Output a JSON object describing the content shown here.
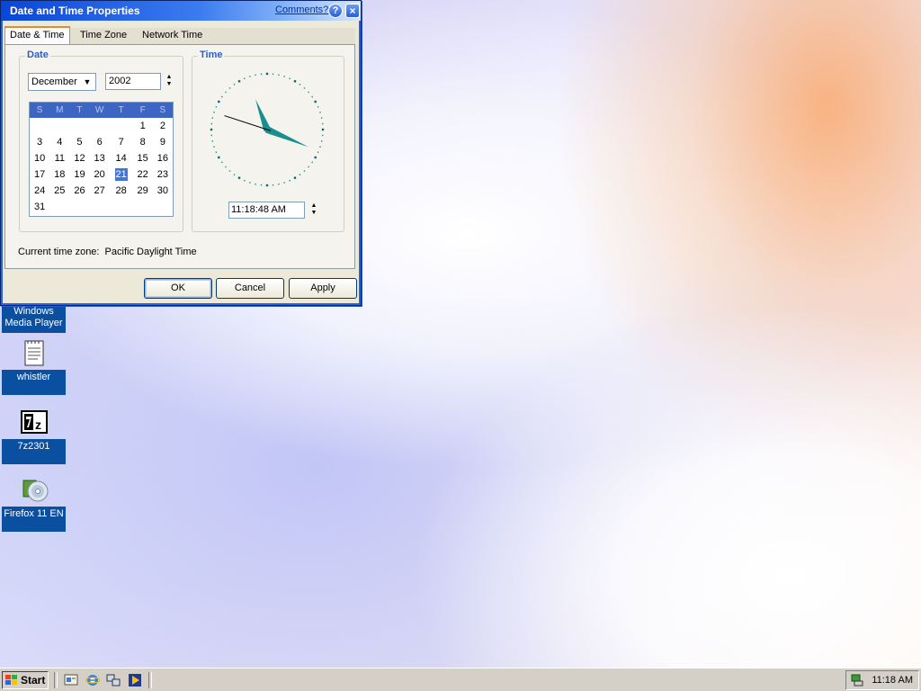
{
  "dialog": {
    "title": "Date and Time Properties",
    "comments_link": "Comments?",
    "help_label": "?",
    "close_label": "×",
    "tabs": [
      {
        "label": "Date & Time",
        "active": true
      },
      {
        "label": "Time Zone",
        "active": false
      },
      {
        "label": "Network Time",
        "active": false
      }
    ],
    "date_group_title": "Date",
    "time_group_title": "Time",
    "month_value": "December",
    "year_value": "2002",
    "calendar": {
      "day_headers": [
        "S",
        "M",
        "T",
        "W",
        "T",
        "F",
        "S"
      ],
      "weeks": [
        [
          "",
          "",
          "",
          "",
          "",
          "1",
          "2"
        ],
        [
          "3",
          "4",
          "5",
          "6",
          "7",
          "8",
          "9"
        ],
        [
          "10",
          "11",
          "12",
          "13",
          "14",
          "15",
          "16"
        ],
        [
          "17",
          "18",
          "19",
          "20",
          "21",
          "22",
          "23"
        ],
        [
          "24",
          "25",
          "26",
          "27",
          "28",
          "29",
          "30"
        ],
        [
          "31",
          "",
          "",
          "",
          "",
          "",
          ""
        ]
      ],
      "selected_day": "21"
    },
    "clock": {
      "hours": 11,
      "minutes": 18,
      "seconds": 48
    },
    "time_value": "11:18:48 AM",
    "timezone_label": "Current time zone:",
    "timezone_value": "Pacific Daylight Time",
    "buttons": {
      "ok": "OK",
      "cancel": "Cancel",
      "apply": "Apply"
    }
  },
  "desktop_icons": [
    {
      "label": "Windows Media Player",
      "icon": "windows-media-player-icon"
    },
    {
      "label": "whistler",
      "icon": "notepad-icon"
    },
    {
      "label": "7z2301",
      "icon": "7zip-icon"
    },
    {
      "label": "Firefox 11 EN",
      "icon": "installer-cd-icon"
    }
  ],
  "taskbar": {
    "start_label": "Start",
    "clock": "11:18 AM",
    "quick_launch": [
      "show-desktop-icon",
      "internet-explorer-icon",
      "network-icon",
      "media-player-icon"
    ]
  },
  "colors": {
    "titlebar": "#0a46d6",
    "group_title": "#2b5fcf",
    "calendar_header": "#3d66c4",
    "selection": "#3f76d8",
    "icon_label_bg": "#0b4fa0",
    "clock_hand": "#178f8f"
  }
}
